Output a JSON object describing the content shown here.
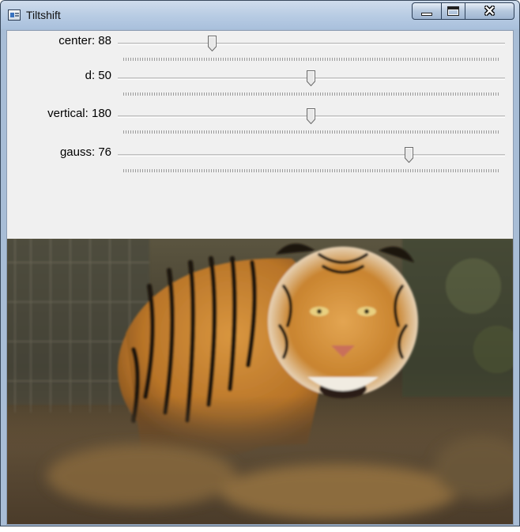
{
  "window": {
    "title": "Tiltshift",
    "icon": "app-window-icon",
    "controls": [
      "minimize-icon",
      "maximize-icon",
      "close-icon"
    ]
  },
  "sliders": [
    {
      "label": "center: 88",
      "value": 88,
      "max": 359
    },
    {
      "label": "d: 50",
      "value": 50,
      "max": 100
    },
    {
      "label": "vertical: 180",
      "value": 180,
      "max": 360
    },
    {
      "label": "gauss: 76",
      "value": 76,
      "max": 101
    }
  ],
  "image": {
    "subject": "tiger photograph with tilt-shift blur"
  }
}
